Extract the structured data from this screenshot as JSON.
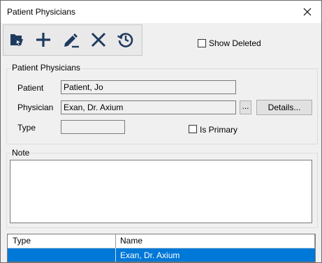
{
  "window": {
    "title": "Patient Physicians"
  },
  "toolbar": {
    "buttons": [
      {
        "name": "open",
        "icon": "open-record-icon"
      },
      {
        "name": "add",
        "icon": "plus-icon"
      },
      {
        "name": "edit",
        "icon": "pencil-icon"
      },
      {
        "name": "delete",
        "icon": "x-icon"
      },
      {
        "name": "history",
        "icon": "history-clock-icon"
      }
    ],
    "icon_color": "#1e3a5f"
  },
  "show_deleted": {
    "label": "Show Deleted",
    "checked": false
  },
  "patient_physicians_group": {
    "legend": "Patient Physicians",
    "patient_label": "Patient",
    "patient_value": "Patient, Jo",
    "physician_label": "Physician",
    "physician_value": "Exan, Dr. Axium",
    "browse_label": "...",
    "details_label": "Details...",
    "type_label": "Type",
    "type_value": "",
    "is_primary_label": "Is Primary",
    "is_primary_checked": false
  },
  "note_group": {
    "legend": "Note",
    "value": ""
  },
  "grid": {
    "columns": [
      "Type",
      "Name"
    ],
    "rows": [
      {
        "type": "",
        "name": "Exan, Dr. Axium",
        "selected": true
      }
    ],
    "selection_color": "#0078d7"
  }
}
